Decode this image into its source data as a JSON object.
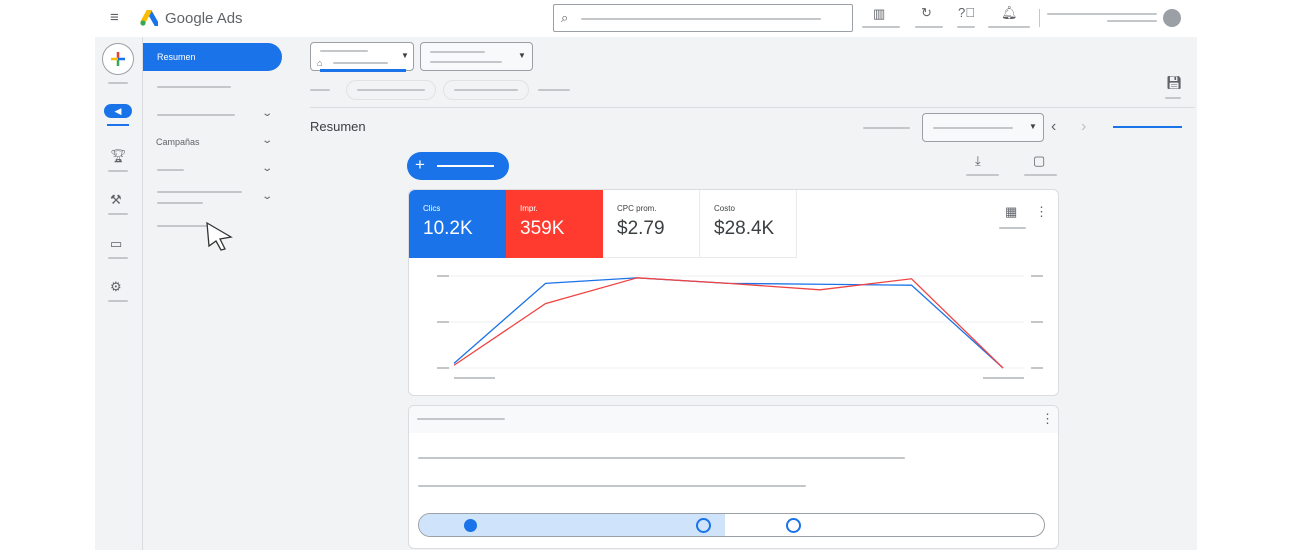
{
  "header": {
    "app_name": "Google Ads",
    "icons": [
      "menu-icon",
      "search-icon",
      "campaigns-icon",
      "refresh-icon",
      "help-icon",
      "notifications-icon",
      "avatar"
    ]
  },
  "rail": {
    "icons": [
      "create-plus-icon",
      "campaigns-icon",
      "goals-trophy-icon",
      "tools-icon",
      "billing-card-icon",
      "settings-gear-icon"
    ]
  },
  "nav": {
    "active": "Resumen",
    "campaigns": "Campañas"
  },
  "main": {
    "title": "Resumen",
    "new_button_icon": "plus-icon"
  },
  "metrics": [
    {
      "label": "Clics",
      "value": "10.2K",
      "color": "#1a73e8"
    },
    {
      "label": "Impr.",
      "value": "359K",
      "color": "#ff3b2f"
    },
    {
      "label": "CPC prom.",
      "value": "$2.79"
    },
    {
      "label": "Costo",
      "value": "$28.4K"
    }
  ],
  "chart_data": {
    "type": "line",
    "ylim": [
      0,
      100
    ],
    "x": [
      0,
      1,
      2,
      3,
      4,
      5,
      6
    ],
    "series": [
      {
        "name": "Clics",
        "color": "#1a73e8",
        "values": [
          5,
          92,
          98,
          92,
          91,
          90,
          0
        ]
      },
      {
        "name": "Impr.",
        "color": "#ef4444",
        "values": [
          3,
          70,
          98,
          92,
          85,
          97,
          0
        ]
      }
    ]
  },
  "progress": {
    "fraction": 0.49,
    "steps": 3
  }
}
